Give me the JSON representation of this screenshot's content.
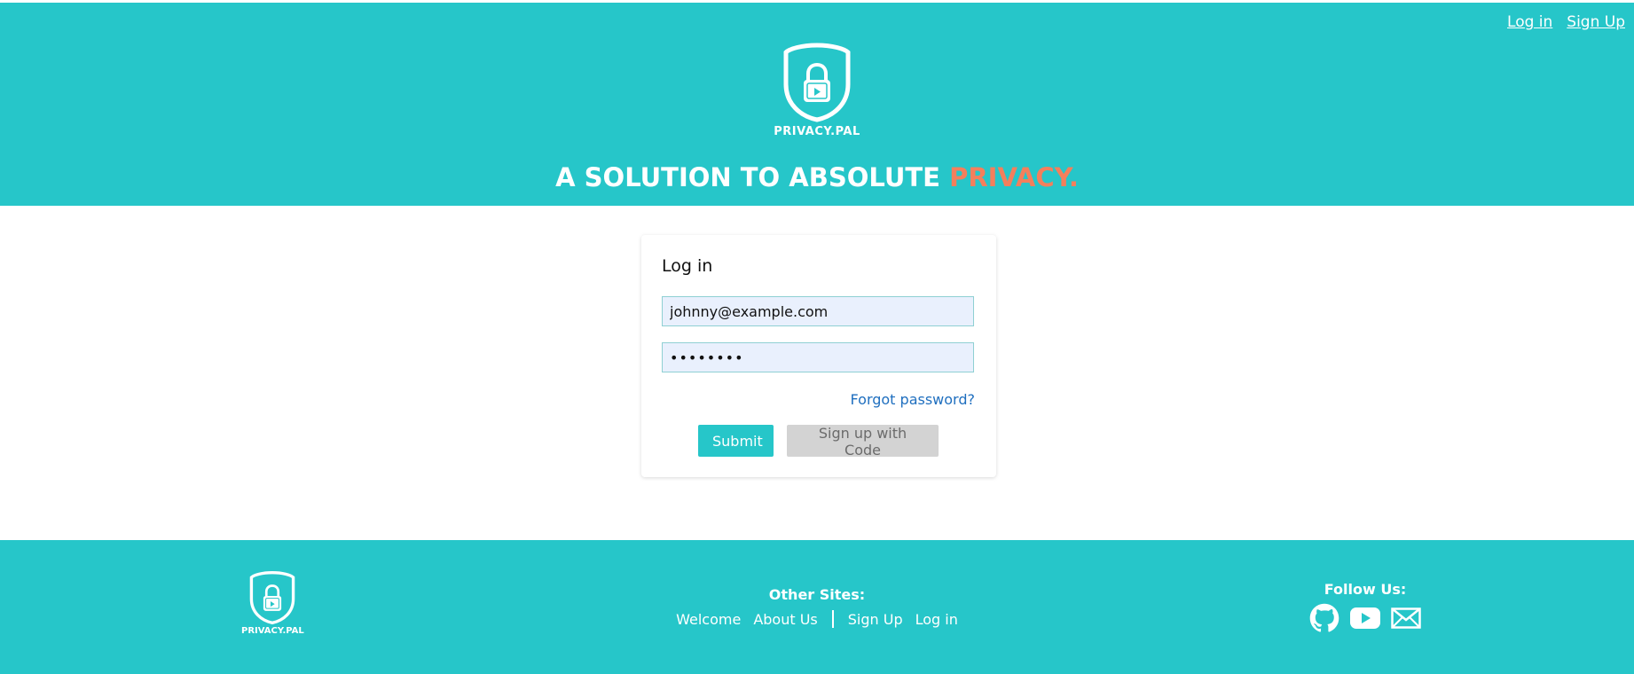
{
  "header": {
    "nav": {
      "login_label": "Log in",
      "signup_label": "Sign Up"
    },
    "brand_name": "PRIVACY.PAL",
    "tagline_main": "A SOLUTION TO ABSOLUTE ",
    "tagline_accent": "PRIVACY."
  },
  "login": {
    "title": "Log in",
    "email_value": "johnny@example.com",
    "password_value": "••••••••",
    "forgot_label": "Forgot password?",
    "submit_label": "Submit",
    "signup_code_label": "Sign up with Code"
  },
  "footer": {
    "brand_name": "PRIVACY.PAL",
    "other_sites_title": "Other Sites:",
    "links": {
      "welcome": "Welcome",
      "about": "About Us",
      "signup": "Sign Up",
      "login": "Log in"
    },
    "follow_title": "Follow Us:",
    "social_icons": [
      "github-icon",
      "youtube-icon",
      "mail-icon"
    ]
  },
  "colors": {
    "brand_teal": "#26c6c9",
    "accent_orange": "#f47f5c",
    "link_blue": "#1f6fbf"
  }
}
